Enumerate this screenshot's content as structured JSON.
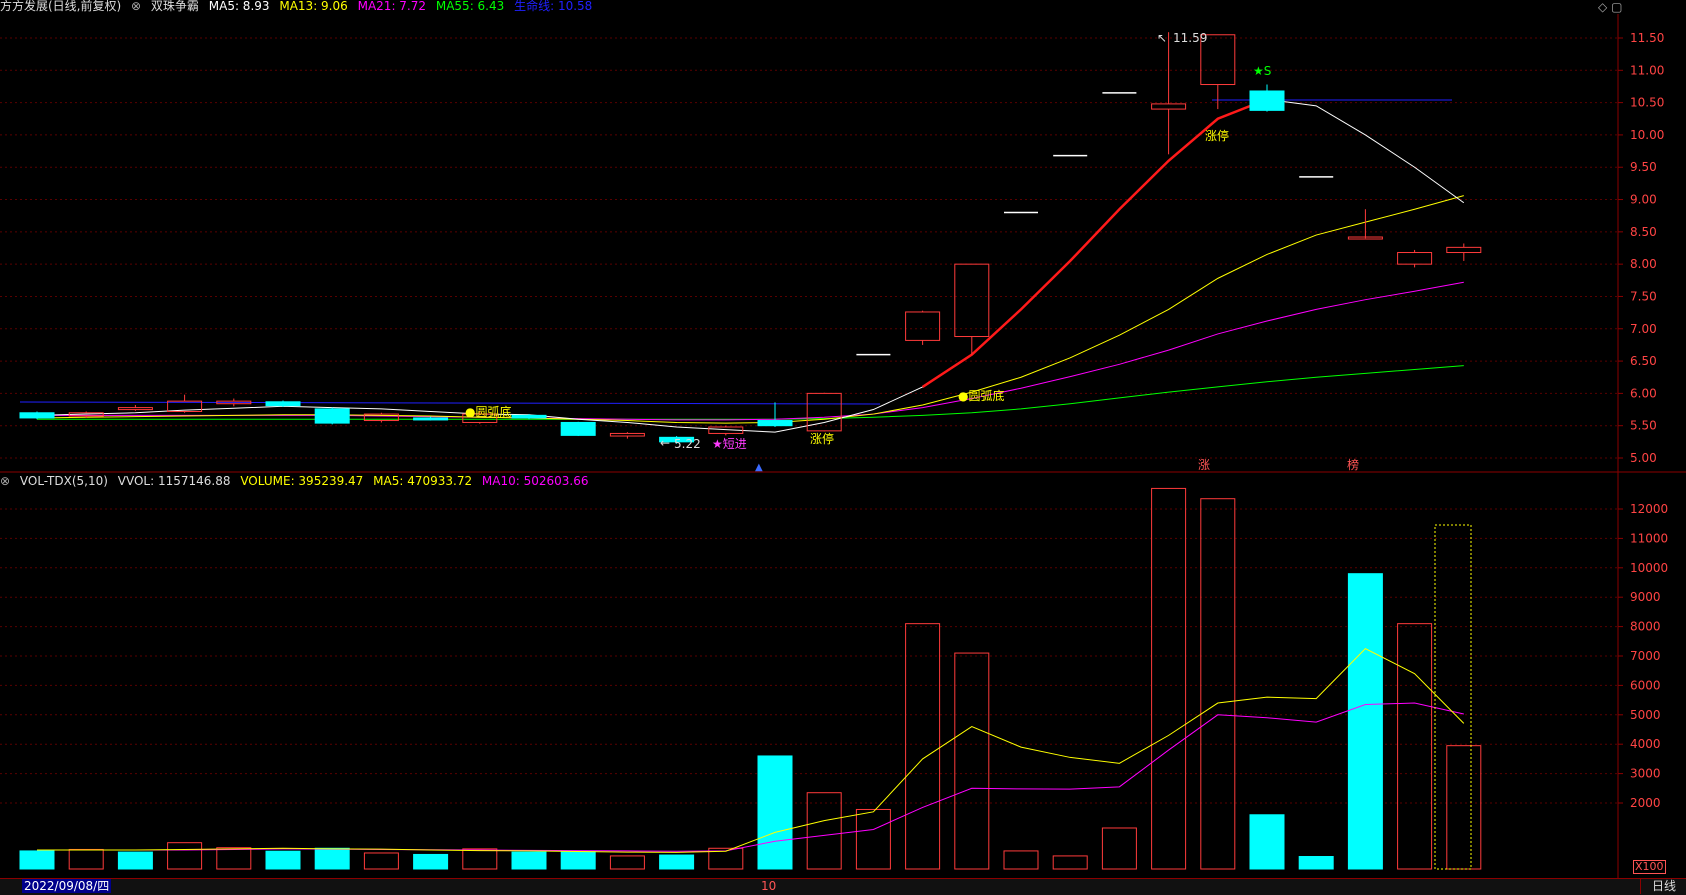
{
  "header": {
    "stock": "方方发展(日线,前复权)",
    "indicator": "双珠争霸",
    "ma5": "MA5: 8.93",
    "ma13": "MA13: 9.06",
    "ma21": "MA21: 7.72",
    "ma55": "MA55: 6.43",
    "baseline": "生命线: 10.58"
  },
  "vol_header": {
    "name": "VOL-TDX(5,10)",
    "vvol": "VVOL: 1157146.88",
    "volume": "VOLUME: 395239.47",
    "ma5": "MA5: 470933.72",
    "ma10": "MA10: 502603.66"
  },
  "annotations": {
    "high": "11.59",
    "low": "5.22",
    "signal_s": "★S",
    "zt1": "涨停",
    "zt2": "涨停",
    "yuanhu1": "●圆弧底",
    "yuanhu2": "●圆弧底",
    "duanjin": "★短进",
    "zhang": "涨",
    "bang": "榜"
  },
  "price_axis": [
    "11.50",
    "11.00",
    "10.50",
    "10.00",
    "9.50",
    "9.00",
    "8.50",
    "8.00",
    "7.50",
    "7.00",
    "6.50",
    "6.00",
    "5.50",
    "5.00"
  ],
  "vol_axis": [
    "12000",
    "11000",
    "10000",
    "9000",
    "8000",
    "7000",
    "6000",
    "5000",
    "4000",
    "3000",
    "2000"
  ],
  "footer": {
    "date": "2022/09/08/四",
    "mid": "10",
    "period": "日线",
    "unit": "X100"
  },
  "colors": {
    "up": "#ff3b3b",
    "down": "#00ffff",
    "ma5": "#ffffff",
    "ma13": "#ffff00",
    "ma21": "#ff00ff",
    "ma55": "#00ff00",
    "baseline": "#2020ff"
  },
  "chart_data": {
    "type": "candlestick",
    "candles": [
      {
        "o": 5.62,
        "c": 5.7,
        "h": 5.72,
        "l": 5.6,
        "dir": "down"
      },
      {
        "o": 5.65,
        "c": 5.7,
        "h": 5.72,
        "l": 5.62,
        "dir": "up"
      },
      {
        "o": 5.75,
        "c": 5.78,
        "h": 5.82,
        "l": 5.73,
        "dir": "up"
      },
      {
        "o": 5.72,
        "c": 5.88,
        "h": 5.98,
        "l": 5.7,
        "dir": "up"
      },
      {
        "o": 5.84,
        "c": 5.88,
        "h": 5.92,
        "l": 5.8,
        "dir": "up"
      },
      {
        "o": 5.87,
        "c": 5.81,
        "h": 5.89,
        "l": 5.79,
        "dir": "down"
      },
      {
        "o": 5.76,
        "c": 5.54,
        "h": 5.78,
        "l": 5.52,
        "dir": "down"
      },
      {
        "o": 5.58,
        "c": 5.68,
        "h": 5.7,
        "l": 5.55,
        "dir": "up"
      },
      {
        "o": 5.62,
        "c": 5.6,
        "h": 5.64,
        "l": 5.58,
        "dir": "down"
      },
      {
        "o": 5.55,
        "c": 5.68,
        "h": 5.72,
        "l": 5.53,
        "dir": "up"
      },
      {
        "o": 5.66,
        "c": 5.62,
        "h": 5.68,
        "l": 5.6,
        "dir": "down"
      },
      {
        "o": 5.55,
        "c": 5.35,
        "h": 5.56,
        "l": 5.34,
        "dir": "down"
      },
      {
        "o": 5.34,
        "c": 5.38,
        "h": 5.4,
        "l": 5.3,
        "dir": "up"
      },
      {
        "o": 5.32,
        "c": 5.25,
        "h": 5.34,
        "l": 5.22,
        "dir": "down"
      },
      {
        "o": 5.38,
        "c": 5.48,
        "h": 5.5,
        "l": 5.35,
        "dir": "up"
      },
      {
        "o": 5.5,
        "c": 5.58,
        "h": 5.86,
        "l": 5.48,
        "dir": "down"
      },
      {
        "o": 5.42,
        "c": 6.0,
        "h": 6.01,
        "l": 5.41,
        "dir": "up"
      },
      {
        "o": 6.6,
        "c": 6.6,
        "h": 6.6,
        "l": 6.6,
        "dir": "up"
      },
      {
        "o": 6.82,
        "c": 7.26,
        "h": 7.28,
        "l": 6.75,
        "dir": "up"
      },
      {
        "o": 6.88,
        "c": 8.0,
        "h": 8.0,
        "l": 6.6,
        "dir": "up"
      },
      {
        "o": 8.8,
        "c": 8.8,
        "h": 8.8,
        "l": 8.8,
        "dir": "up"
      },
      {
        "o": 9.68,
        "c": 9.68,
        "h": 9.68,
        "l": 9.68,
        "dir": "up"
      },
      {
        "o": 10.65,
        "c": 10.65,
        "h": 10.65,
        "l": 10.65,
        "dir": "up"
      },
      {
        "o": 10.4,
        "c": 10.48,
        "h": 11.59,
        "l": 9.7,
        "dir": "up"
      },
      {
        "o": 10.78,
        "c": 11.55,
        "h": 11.55,
        "l": 10.4,
        "dir": "up"
      },
      {
        "o": 10.68,
        "c": 10.38,
        "h": 10.78,
        "l": 10.36,
        "dir": "down"
      },
      {
        "o": 9.35,
        "c": 9.35,
        "h": 9.35,
        "l": 9.35,
        "dir": "up"
      },
      {
        "o": 8.42,
        "c": 8.42,
        "h": 8.85,
        "l": 8.4,
        "dir": "up"
      },
      {
        "o": 8.0,
        "c": 8.18,
        "h": 8.22,
        "l": 7.95,
        "dir": "up"
      },
      {
        "o": 8.18,
        "c": 8.26,
        "h": 8.32,
        "l": 8.05,
        "dir": "up"
      }
    ],
    "volume": [
      {
        "v": 370,
        "dir": "down"
      },
      {
        "v": 420,
        "dir": "up"
      },
      {
        "v": 330,
        "dir": "down"
      },
      {
        "v": 650,
        "dir": "up"
      },
      {
        "v": 480,
        "dir": "up"
      },
      {
        "v": 360,
        "dir": "down"
      },
      {
        "v": 460,
        "dir": "down"
      },
      {
        "v": 300,
        "dir": "up"
      },
      {
        "v": 250,
        "dir": "down"
      },
      {
        "v": 440,
        "dir": "up"
      },
      {
        "v": 330,
        "dir": "down"
      },
      {
        "v": 360,
        "dir": "down"
      },
      {
        "v": 200,
        "dir": "up"
      },
      {
        "v": 230,
        "dir": "down"
      },
      {
        "v": 460,
        "dir": "up"
      },
      {
        "v": 3600,
        "dir": "down"
      },
      {
        "v": 2350,
        "dir": "up"
      },
      {
        "v": 1780,
        "dir": "up"
      },
      {
        "v": 8100,
        "dir": "up"
      },
      {
        "v": 7100,
        "dir": "up"
      },
      {
        "v": 370,
        "dir": "up"
      },
      {
        "v": 200,
        "dir": "up"
      },
      {
        "v": 1150,
        "dir": "up"
      },
      {
        "v": 12700,
        "dir": "up"
      },
      {
        "v": 12350,
        "dir": "up"
      },
      {
        "v": 1600,
        "dir": "down"
      },
      {
        "v": 180,
        "dir": "down"
      },
      {
        "v": 9800,
        "dir": "down"
      },
      {
        "v": 8100,
        "dir": "up"
      },
      {
        "v": 3950,
        "dir": "up"
      }
    ],
    "ma5": [
      5.66,
      5.68,
      5.7,
      5.74,
      5.77,
      5.8,
      5.78,
      5.76,
      5.72,
      5.68,
      5.67,
      5.6,
      5.55,
      5.48,
      5.44,
      5.4,
      5.55,
      5.75,
      6.1,
      6.6,
      7.3,
      8.05,
      8.85,
      9.6,
      10.25,
      10.55,
      10.45,
      10.0,
      9.5,
      8.95
    ],
    "ma13": [
      5.62,
      5.63,
      5.64,
      5.65,
      5.66,
      5.67,
      5.67,
      5.66,
      5.65,
      5.63,
      5.62,
      5.6,
      5.58,
      5.55,
      5.54,
      5.55,
      5.6,
      5.68,
      5.82,
      6.02,
      6.25,
      6.55,
      6.9,
      7.3,
      7.78,
      8.15,
      8.45,
      8.65,
      8.85,
      9.06
    ],
    "ma21": [
      5.66,
      5.66,
      5.66,
      5.66,
      5.66,
      5.66,
      5.66,
      5.65,
      5.64,
      5.63,
      5.62,
      5.61,
      5.6,
      5.59,
      5.59,
      5.6,
      5.63,
      5.68,
      5.78,
      5.92,
      6.08,
      6.26,
      6.45,
      6.67,
      6.92,
      7.12,
      7.3,
      7.45,
      7.58,
      7.72
    ],
    "ma55": [
      5.6,
      5.6,
      5.6,
      5.6,
      5.6,
      5.6,
      5.6,
      5.6,
      5.6,
      5.6,
      5.6,
      5.6,
      5.6,
      5.6,
      5.6,
      5.6,
      5.61,
      5.63,
      5.66,
      5.7,
      5.76,
      5.84,
      5.93,
      6.02,
      6.1,
      6.18,
      6.25,
      6.31,
      6.37,
      6.43
    ],
    "vol_ma5": [
      400,
      400,
      400,
      420,
      440,
      460,
      440,
      430,
      400,
      380,
      370,
      350,
      330,
      320,
      360,
      1000,
      1400,
      1700,
      3500,
      4600,
      3900,
      3550,
      3350,
      4300,
      5400,
      5600,
      5550,
      7250,
      6400,
      4709
    ],
    "vol_ma10": [
      400,
      400,
      400,
      400,
      420,
      440,
      430,
      420,
      410,
      400,
      390,
      380,
      370,
      360,
      370,
      700,
      900,
      1100,
      1850,
      2500,
      2480,
      2470,
      2550,
      3800,
      5000,
      4900,
      4750,
      5350,
      5400,
      5026
    ],
    "baseline_value": 10.58
  }
}
